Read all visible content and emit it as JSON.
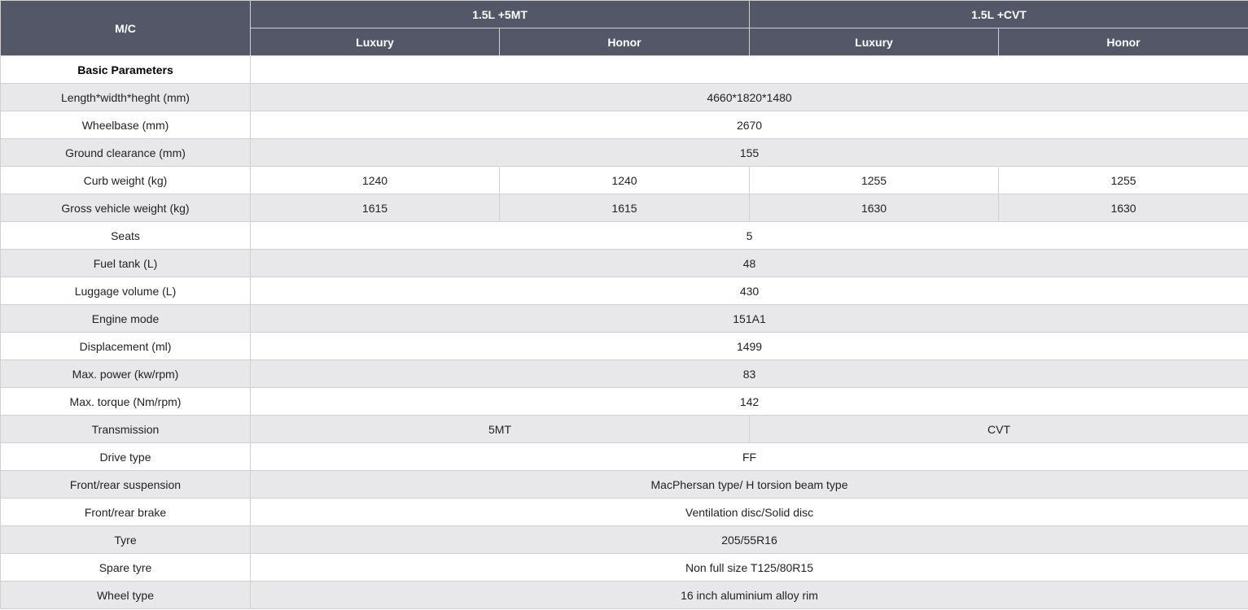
{
  "header": {
    "model_label": "M/C",
    "groups": [
      {
        "label": "1.5L +5MT"
      },
      {
        "label": "1.5L +CVT"
      }
    ],
    "trims": [
      {
        "label": "Luxury"
      },
      {
        "label": "Honor"
      },
      {
        "label": "Luxury"
      },
      {
        "label": "Honor"
      }
    ]
  },
  "section": {
    "title": "Basic Parameters"
  },
  "rows": {
    "dimensions": {
      "label": "Length*width*heght (mm)",
      "value": "4660*1820*1480"
    },
    "wheelbase": {
      "label": "Wheelbase (mm)",
      "value": "2670"
    },
    "ground_clearance": {
      "label": "Ground clearance (mm)",
      "value": "155"
    },
    "curb_weight": {
      "label": "Curb weight (kg)",
      "values": [
        "1240",
        "1240",
        "1255",
        "1255"
      ]
    },
    "gross_weight": {
      "label": "Gross vehicle weight (kg)",
      "values": [
        "1615",
        "1615",
        "1630",
        "1630"
      ]
    },
    "seats": {
      "label": "Seats",
      "value": "5"
    },
    "fuel_tank": {
      "label": "Fuel tank (L)",
      "value": "48"
    },
    "luggage": {
      "label": "Luggage volume (L)",
      "value": "430"
    },
    "engine_mode": {
      "label": "Engine mode",
      "value": "151A1"
    },
    "displacement": {
      "label": "Displacement (ml)",
      "value": "1499"
    },
    "max_power": {
      "label": "Max. power (kw/rpm)",
      "value": "83"
    },
    "max_torque": {
      "label": "Max. torque (Nm/rpm)",
      "value": "142"
    },
    "transmission": {
      "label": "Transmission",
      "values": [
        "5MT",
        "CVT"
      ]
    },
    "drive_type": {
      "label": "Drive type",
      "value": "FF"
    },
    "suspension": {
      "label": "Front/rear suspension",
      "value": "MacPhersan type/ H torsion beam type"
    },
    "brake": {
      "label": "Front/rear brake",
      "value": "Ventilation disc/Solid disc"
    },
    "tyre": {
      "label": "Tyre",
      "value": "205/55R16"
    },
    "spare_tyre": {
      "label": "Spare tyre",
      "value": "Non full size T125/80R15"
    },
    "wheel_type": {
      "label": "Wheel type",
      "value": "16 inch aluminium alloy rim"
    }
  }
}
